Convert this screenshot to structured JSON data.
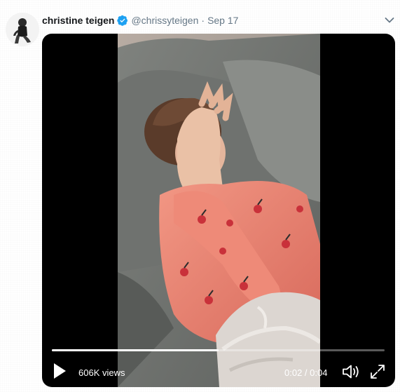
{
  "tweet": {
    "display_name": "christine teigen",
    "handle": "@chrissyteigen",
    "separator": "·",
    "timestamp": "Sep 17",
    "verified": true,
    "menu_icon": "chevron-down-icon"
  },
  "video": {
    "views": "606K views",
    "time_readout": "0:02 / 0:04",
    "progress": 0.5,
    "play_icon": "play-icon",
    "volume_icon": "volume-icon",
    "fullscreen_icon": "fullscreen-icon"
  },
  "colors": {
    "name": "#14171a",
    "secondary": "#657786",
    "verified": "#1da1f2",
    "video_bg": "#000000"
  }
}
